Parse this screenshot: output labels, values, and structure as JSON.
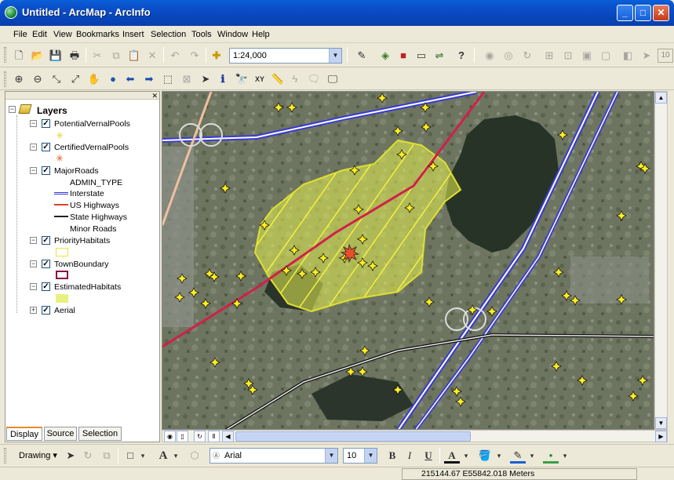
{
  "window": {
    "title": "Untitled - ArcMap - ArcInfo"
  },
  "menu": [
    "File",
    "Edit",
    "View",
    "Bookmarks",
    "Insert",
    "Selection",
    "Tools",
    "Window",
    "Help"
  ],
  "toolbar": {
    "scale_value": "1:24,000",
    "overflow_glyph": "10"
  },
  "toc": {
    "root_label": "Layers",
    "layers": [
      {
        "name": "PotentialVernalPools",
        "checked": true
      },
      {
        "name": "CertifiedVernalPools",
        "checked": true
      },
      {
        "name": "MajorRoads",
        "checked": true,
        "field": "ADMIN_TYPE",
        "classes": [
          "Interstate",
          "US Highways",
          "State Highways",
          "Minor Roads"
        ]
      },
      {
        "name": "PriorityHabitats",
        "checked": true
      },
      {
        "name": "TownBoundary",
        "checked": true
      },
      {
        "name": "EstimatedHabitats",
        "checked": true
      },
      {
        "name": "Aerial",
        "checked": true
      }
    ],
    "tabs": [
      "Display",
      "Source",
      "Selection"
    ]
  },
  "drawing_toolbar": {
    "drawing_label": "Drawing",
    "font_name": "Arial",
    "font_size": "10",
    "bold": "B",
    "italic": "I",
    "underline": "U"
  },
  "status": {
    "coordinates": "215144.67  E55842.018 Meters"
  },
  "colors": {
    "interstate": "#3a3ad0",
    "us_highway": "#d8442c",
    "state_highway": "#222222",
    "priority_habitat": "#f0f060",
    "town_boundary": "#8a1040",
    "estimated_habitat": "#e8f080"
  }
}
